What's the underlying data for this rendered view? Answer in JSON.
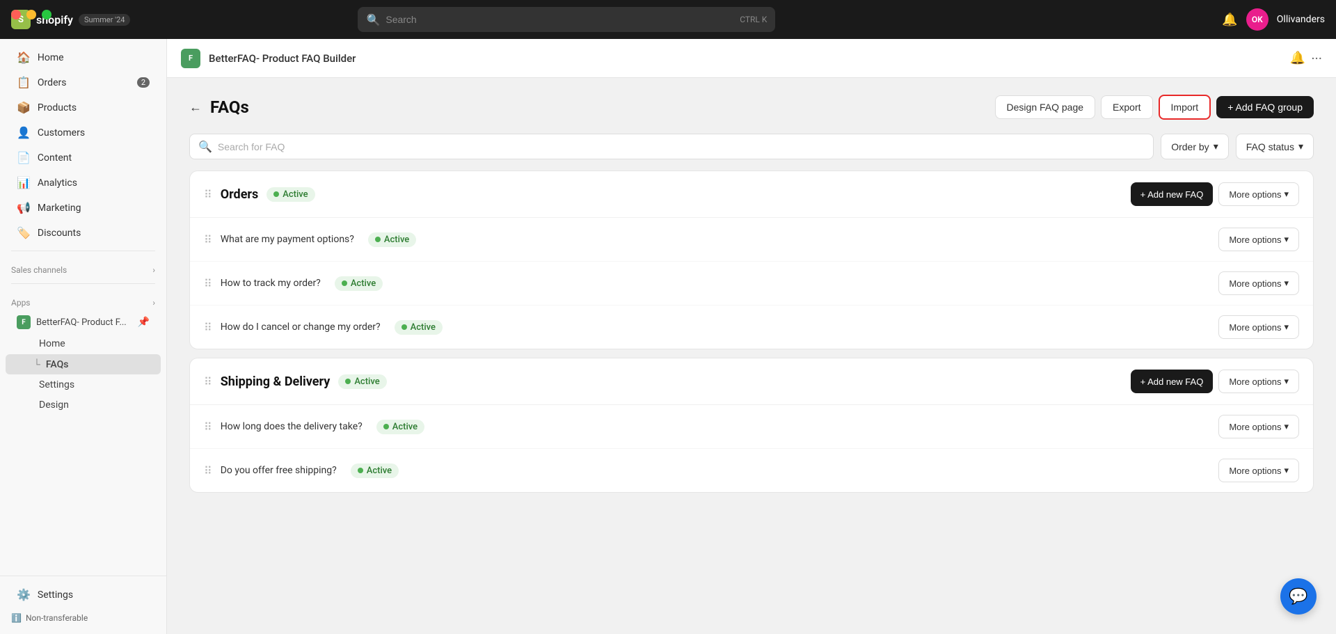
{
  "window": {
    "controls": [
      "red",
      "yellow",
      "green"
    ]
  },
  "topbar": {
    "logo_letter": "S",
    "wordmark": "shopify",
    "badge": "Summer '24",
    "search_placeholder": "Search",
    "search_shortcut_key1": "CTRL",
    "search_shortcut_key2": "K",
    "bell_icon": "🔔",
    "avatar_initials": "OK",
    "store_name": "Ollivanders"
  },
  "sidebar": {
    "nav_items": [
      {
        "id": "home",
        "label": "Home",
        "icon": "🏠",
        "badge": null
      },
      {
        "id": "orders",
        "label": "Orders",
        "icon": "📋",
        "badge": "2"
      },
      {
        "id": "products",
        "label": "Products",
        "icon": "📦",
        "badge": null
      },
      {
        "id": "customers",
        "label": "Customers",
        "icon": "👤",
        "badge": null
      },
      {
        "id": "content",
        "label": "Content",
        "icon": "📄",
        "badge": null
      },
      {
        "id": "analytics",
        "label": "Analytics",
        "icon": "📊",
        "badge": null
      },
      {
        "id": "marketing",
        "label": "Marketing",
        "icon": "📢",
        "badge": null
      },
      {
        "id": "discounts",
        "label": "Discounts",
        "icon": "🏷️",
        "badge": null
      }
    ],
    "sales_channels_label": "Sales channels",
    "apps_label": "Apps",
    "app_name": "BetterFAQ- Product F...",
    "app_sub_items": [
      {
        "id": "app-home",
        "label": "Home"
      },
      {
        "id": "app-faqs",
        "label": "FAQs",
        "active": true
      },
      {
        "id": "app-settings",
        "label": "Settings"
      },
      {
        "id": "app-design",
        "label": "Design"
      }
    ],
    "settings_label": "Settings",
    "non_transferable_label": "Non-transferable"
  },
  "app_header": {
    "icon_text": "F",
    "title": "BetterFAQ- Product FAQ Builder",
    "bell_icon": "🔔",
    "more_icon": "···"
  },
  "page": {
    "back_label": "←",
    "title": "FAQs",
    "actions": {
      "design_faq_page": "Design FAQ page",
      "export": "Export",
      "import": "Import",
      "add_faq_group": "+ Add FAQ group"
    },
    "search_placeholder": "Search for FAQ",
    "order_by_label": "Order by",
    "faq_status_label": "FAQ status",
    "groups": [
      {
        "id": "orders",
        "title": "Orders",
        "status": "Active",
        "add_faq_label": "+ Add new FAQ",
        "more_options_label": "More options",
        "items": [
          {
            "question": "What are my payment options?",
            "status": "Active",
            "more_options_label": "More options"
          },
          {
            "question": "How to track my order?",
            "status": "Active",
            "more_options_label": "More options"
          },
          {
            "question": "How do I cancel or change my order?",
            "status": "Active",
            "more_options_label": "More options"
          }
        ]
      },
      {
        "id": "shipping",
        "title": "Shipping & Delivery",
        "status": "Active",
        "add_faq_label": "+ Add new FAQ",
        "more_options_label": "More options",
        "items": [
          {
            "question": "How long does the delivery take?",
            "status": "Active",
            "more_options_label": "More options"
          },
          {
            "question": "Do you offer free shipping?",
            "status": "Active",
            "more_options_label": "More options"
          }
        ]
      }
    ]
  }
}
